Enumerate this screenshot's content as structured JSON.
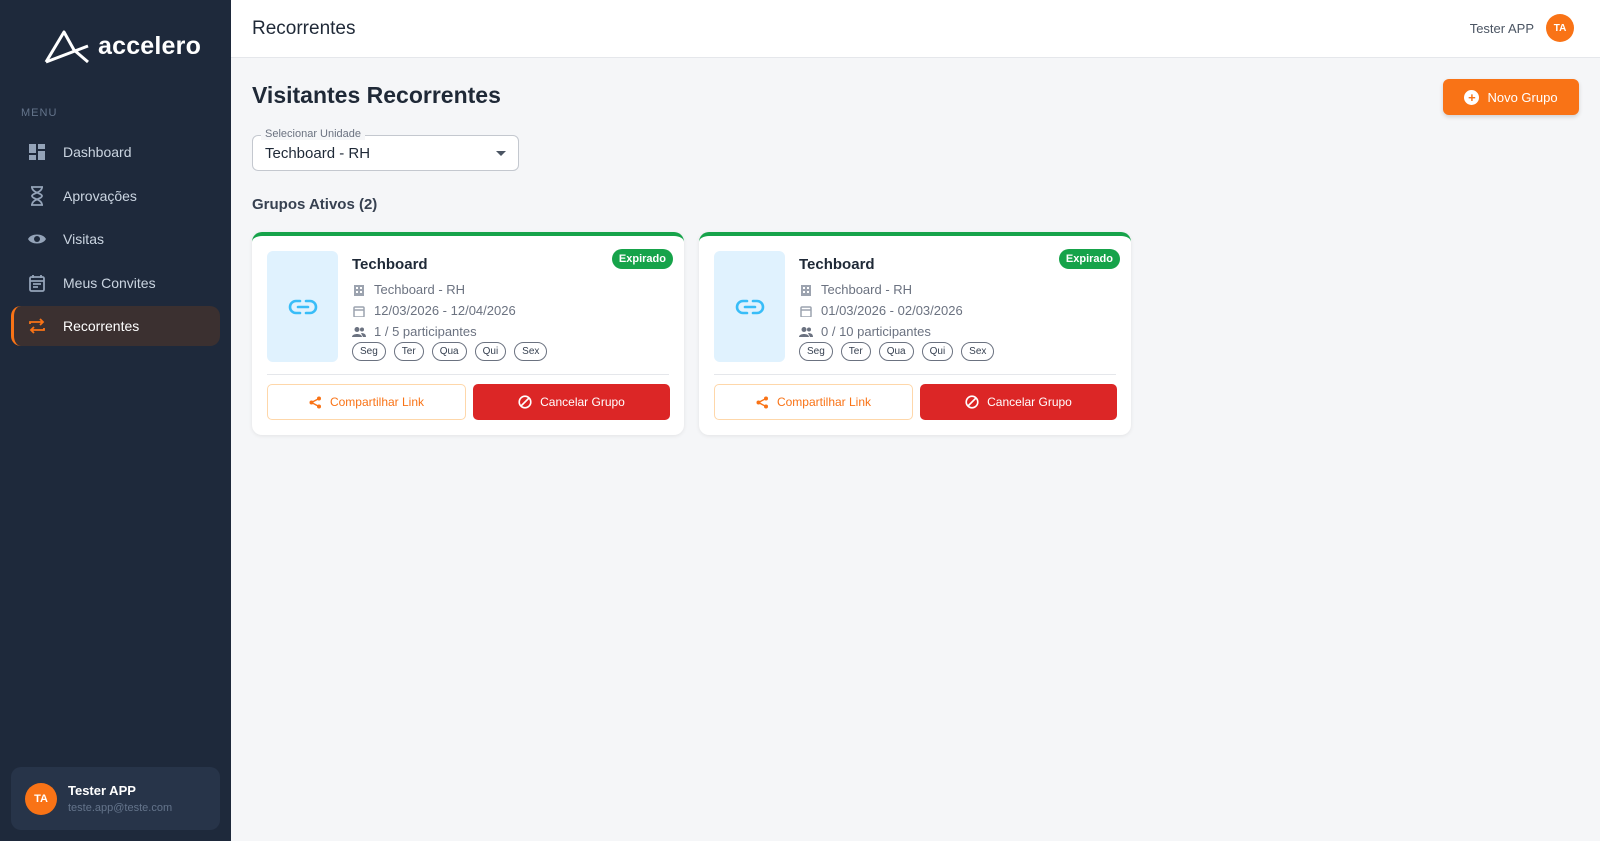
{
  "brand": {
    "name": "accelero"
  },
  "sidebar": {
    "menu_label": "MENU",
    "items": [
      {
        "label": "Dashboard",
        "icon": "dashboard-icon"
      },
      {
        "label": "Aprovações",
        "icon": "hourglass-icon"
      },
      {
        "label": "Visitas",
        "icon": "eye-icon"
      },
      {
        "label": "Meus Convites",
        "icon": "calendar-icon"
      },
      {
        "label": "Recorrentes",
        "icon": "repeat-icon",
        "active": true
      }
    ],
    "user": {
      "initials": "TA",
      "name": "Tester APP",
      "email": "teste.app@teste.com"
    }
  },
  "topbar": {
    "title": "Recorrentes",
    "user_name": "Tester APP",
    "user_initials": "TA"
  },
  "main": {
    "title": "Visitantes Recorrentes",
    "new_button_label": "Novo Grupo",
    "select": {
      "label": "Selecionar Unidade",
      "value": "Techboard - RH"
    },
    "groups_heading": "Grupos Ativos (2)"
  },
  "groups": [
    {
      "name": "Techboard",
      "status": "Expirado",
      "unit": "Techboard - RH",
      "dates": "12/03/2026 - 12/04/2026",
      "participants": "1 / 5 participantes",
      "days": [
        "Seg",
        "Ter",
        "Qua",
        "Qui",
        "Sex"
      ],
      "share_label": "Compartilhar Link",
      "cancel_label": "Cancelar Grupo"
    },
    {
      "name": "Techboard",
      "status": "Expirado",
      "unit": "Techboard - RH",
      "dates": "01/03/2026 - 02/03/2026",
      "participants": "0 / 10 participantes",
      "days": [
        "Seg",
        "Ter",
        "Qua",
        "Qui",
        "Sex"
      ],
      "share_label": "Compartilhar Link",
      "cancel_label": "Cancelar Grupo"
    }
  ],
  "colors": {
    "accent": "#f97316",
    "sidebar": "#1e293b",
    "success": "#16a34a",
    "danger": "#dc2626"
  }
}
